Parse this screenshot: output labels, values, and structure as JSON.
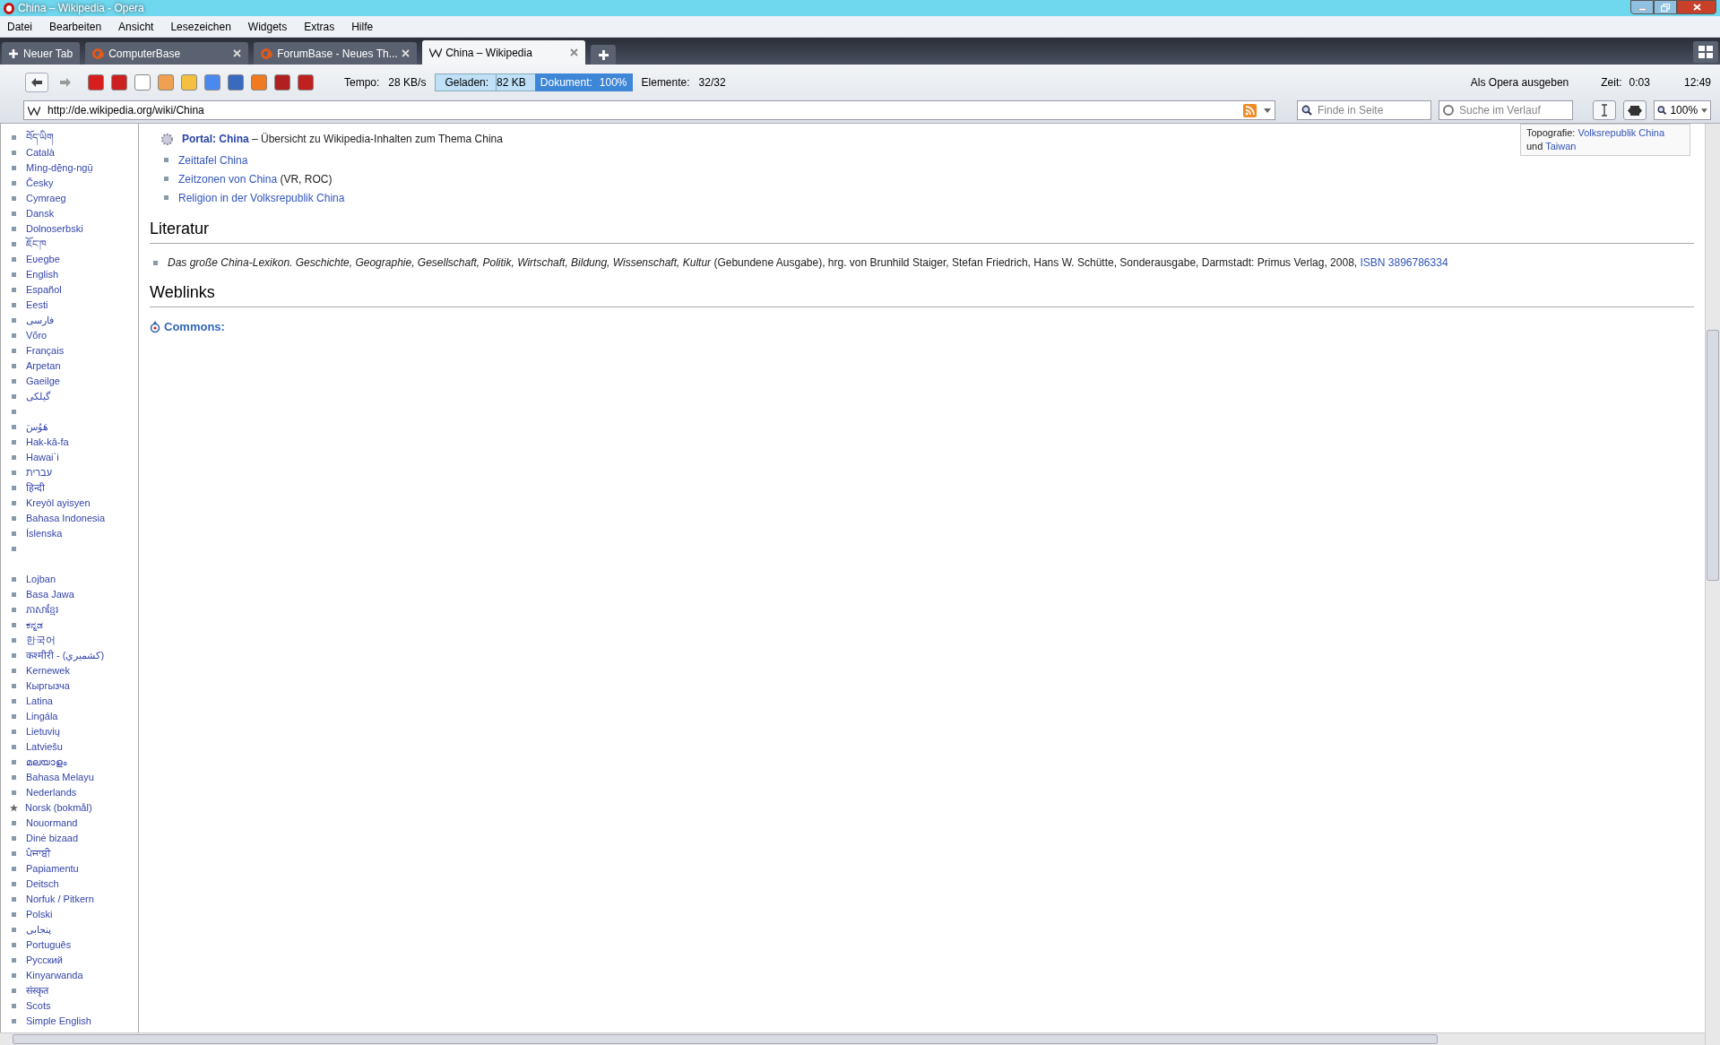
{
  "window": {
    "title": "China – Wikipedia - Opera"
  },
  "menu": [
    "Datei",
    "Bearbeiten",
    "Ansicht",
    "Lesezeichen",
    "Widgets",
    "Extras",
    "Hilfe"
  ],
  "new_tab": {
    "label": "Neuer Tab"
  },
  "tabs": [
    {
      "label": "ComputerBase",
      "kind": "cb",
      "selected": false
    },
    {
      "label": "ForumBase - Neues Th...",
      "kind": "cb",
      "selected": false
    },
    {
      "label": "China – Wikipedia",
      "kind": "wiki",
      "selected": true
    }
  ],
  "status": {
    "tempo_label": "Tempo:",
    "tempo": "28 KB/s",
    "loaded_label": "Geladen:",
    "loaded": "82 KB",
    "document_label": "Dokument:",
    "document": "100%",
    "elements_label": "Elemente:",
    "elements": "32/32",
    "identity": "Als Opera ausgeben",
    "time_label": "Zeit:",
    "time": "0:03",
    "clock": "12:49"
  },
  "address": {
    "value": "http://de.wikipedia.org/wiki/China"
  },
  "find": {
    "placeholder": "Finde in Seite"
  },
  "history": {
    "placeholder": "Suche im Verlauf"
  },
  "zoom": {
    "value": "100%"
  },
  "sidebar": {
    "items": [
      {
        "label": "བོད་ཡིག",
        "kind": "square"
      },
      {
        "label": "Català",
        "kind": "square"
      },
      {
        "label": "Mìng-dĕ̤ng-ngṳ̄",
        "kind": "square"
      },
      {
        "label": "Česky",
        "kind": "square"
      },
      {
        "label": "Cymraeg",
        "kind": "square"
      },
      {
        "label": "Dansk",
        "kind": "square"
      },
      {
        "label": "Dolnoserbski",
        "kind": "square"
      },
      {
        "label": "ཇོང་ཁ",
        "kind": "square"
      },
      {
        "label": "Eʋegbe",
        "kind": "square"
      },
      {
        "label": "English",
        "kind": "square"
      },
      {
        "label": "Español",
        "kind": "square"
      },
      {
        "label": "Eesti",
        "kind": "square"
      },
      {
        "label": "فارسی",
        "kind": "square"
      },
      {
        "label": "Võro",
        "kind": "square"
      },
      {
        "label": "Français",
        "kind": "square"
      },
      {
        "label": "Arpetan",
        "kind": "square"
      },
      {
        "label": "Gaeilge",
        "kind": "square"
      },
      {
        "label": "گیلکی",
        "kind": "square"
      },
      {
        "kind": "empty"
      },
      {
        "label": "هَوُسَ",
        "kind": "square"
      },
      {
        "label": "Hak-kâ-fa",
        "kind": "square"
      },
      {
        "label": "Hawai`i",
        "kind": "square"
      },
      {
        "label": "עברית",
        "kind": "square"
      },
      {
        "label": "हिन्दी",
        "kind": "square"
      },
      {
        "label": "Kreyòl ayisyen",
        "kind": "square"
      },
      {
        "label": "Bahasa Indonesia",
        "kind": "square"
      },
      {
        "label": "Íslenska",
        "kind": "square"
      },
      {
        "kind": "empty"
      },
      {
        "kind": "gap"
      },
      {
        "label": "Lojban",
        "kind": "square"
      },
      {
        "label": "Basa Jawa",
        "kind": "square"
      },
      {
        "label": "ភាសាខ្មែរ",
        "kind": "square"
      },
      {
        "label": "ಕನ್ನಡ",
        "kind": "square"
      },
      {
        "label": "한국어",
        "kind": "square"
      },
      {
        "label": "कश्मीरी - (كشميري)",
        "kind": "square"
      },
      {
        "label": "Kernewek",
        "kind": "square"
      },
      {
        "label": "Кыргызча",
        "kind": "square"
      },
      {
        "label": "Latina",
        "kind": "square"
      },
      {
        "label": "Lingála",
        "kind": "square"
      },
      {
        "label": "Lietuvių",
        "kind": "square"
      },
      {
        "label": "Latviešu",
        "kind": "square"
      },
      {
        "label": "മലയാളം",
        "kind": "square"
      },
      {
        "label": "Bahasa Melayu",
        "kind": "square"
      },
      {
        "label": "Nederlands",
        "kind": "square"
      },
      {
        "label": "Norsk (bokmål)",
        "kind": "star"
      },
      {
        "label": "Nouormand",
        "kind": "square"
      },
      {
        "label": "Dinė bizaad",
        "kind": "square"
      },
      {
        "label": "ਪੰਜਾਬੀ",
        "kind": "square"
      },
      {
        "label": "Papiamentu",
        "kind": "square"
      },
      {
        "label": "Deitsch",
        "kind": "square"
      },
      {
        "label": "Norfuk / Pitkern",
        "kind": "square"
      },
      {
        "label": "Polski",
        "kind": "square"
      },
      {
        "label": "پنجابی",
        "kind": "square"
      },
      {
        "label": "Português",
        "kind": "square"
      },
      {
        "label": "Русский",
        "kind": "square"
      },
      {
        "label": "Kinyarwanda",
        "kind": "square"
      },
      {
        "label": "संस्कृत",
        "kind": "square"
      },
      {
        "label": "Scots",
        "kind": "square"
      },
      {
        "label": "Simple English",
        "kind": "square"
      }
    ]
  },
  "article": {
    "infobox": {
      "label": "Topografie:",
      "link": "Volksrepublik China",
      "and": "und",
      "link2": "Taiwan"
    },
    "portal": {
      "link": "Portal: China",
      "text": "– Übersicht zu Wikipedia-Inhalten zum Thema China"
    },
    "see_also": [
      {
        "link": "Zeittafel China"
      },
      {
        "link": "Zeitzonen von China",
        "text": "(VR, ROC)"
      },
      {
        "link": "Religion in der Volksrepublik China"
      }
    ],
    "sections": [
      {
        "heading": "Literatur",
        "items": [
          {
            "text": "*Das große China-Lexikon. Geschichte, Geographie, Gesellschaft, Politik, Wirtschaft, Bildung, Wissenschaft, Kultur* (Gebundene Ausgabe), hrg. von Brunhild Staiger, Stefan Friedrich, Hans W. Schütte, Sonderausgabe, Darmstadt: Primus Verlag, 2008,",
            "link": "ISBN 3896786334"
          }
        ]
      },
      {
        "heading": "Weblinks",
        "commons": "Commons:"
      }
    ]
  }
}
